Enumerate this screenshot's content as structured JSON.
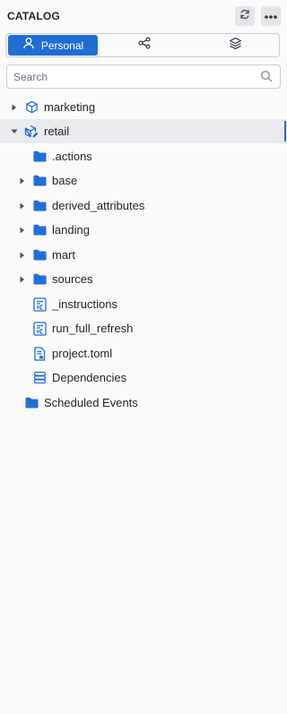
{
  "header": {
    "title": "CATALOG",
    "refresh_icon": "refresh-icon",
    "more_icon": "more-horizontal-icon"
  },
  "tabs": [
    {
      "label": "Personal",
      "icon": "user-icon",
      "active": true
    },
    {
      "label": "",
      "icon": "share-icon",
      "active": false
    },
    {
      "label": "",
      "icon": "layers-icon",
      "active": false
    }
  ],
  "search": {
    "placeholder": "Search",
    "value": ""
  },
  "tree": [
    {
      "label": "marketing",
      "icon": "cube-icon",
      "caret": "right"
    },
    {
      "label": "retail",
      "icon": "cube-edit-icon",
      "caret": "down",
      "selected": true
    },
    {
      "label": ".actions",
      "icon": "folder-icon",
      "caret": null
    },
    {
      "label": "base",
      "icon": "folder-icon",
      "caret": "right"
    },
    {
      "label": "derived_attributes",
      "icon": "folder-icon",
      "caret": "right"
    },
    {
      "label": "landing",
      "icon": "folder-icon",
      "caret": "right"
    },
    {
      "label": "mart",
      "icon": "folder-icon",
      "caret": "right"
    },
    {
      "label": "sources",
      "icon": "folder-icon",
      "caret": "right"
    },
    {
      "label": "_instructions",
      "icon": "script-file-icon",
      "caret": null
    },
    {
      "label": "run_full_refresh",
      "icon": "script-file-icon",
      "caret": null
    },
    {
      "label": "project.toml",
      "icon": "config-file-icon",
      "caret": null
    },
    {
      "label": "Dependencies",
      "icon": "database-icon",
      "caret": null
    },
    {
      "label": "Scheduled Events",
      "icon": "folder-icon",
      "caret": null
    }
  ],
  "colors": {
    "accent": "#1f6ed4",
    "folder": "#1e6fd9",
    "selected_row": "#e9ebee"
  }
}
